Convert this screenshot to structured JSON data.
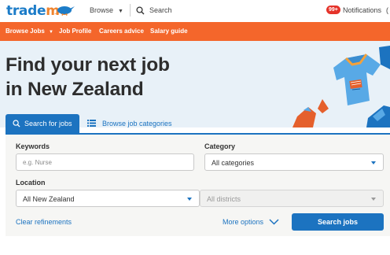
{
  "topbar": {
    "logo_trade": "trade",
    "logo_me": "me",
    "browse_label": "Browse",
    "search_label": "Search",
    "notification_count": "99+",
    "notifications_label": "Notifications",
    "cutoff_char": "("
  },
  "subnav": {
    "items": [
      "Browse Jobs",
      "Job Profile",
      "Careers advice",
      "Salary guide"
    ]
  },
  "hero": {
    "title_line1": "Find your next job",
    "title_line2": "in New Zealand"
  },
  "tabs": {
    "search_jobs": "Search for jobs",
    "browse_categories": "Browse job categories"
  },
  "form": {
    "keywords_label": "Keywords",
    "keywords_placeholder": "e.g. Nurse",
    "category_label": "Category",
    "category_value": "All categories",
    "location_label": "Location",
    "location_value": "All New Zealand",
    "district_value": "All districts",
    "clear_label": "Clear refinements",
    "more_label": "More options",
    "submit_label": "Search jobs"
  },
  "colors": {
    "brand_blue": "#1c73c0",
    "brand_orange": "#f4662b",
    "badge_red": "#e5332a"
  }
}
